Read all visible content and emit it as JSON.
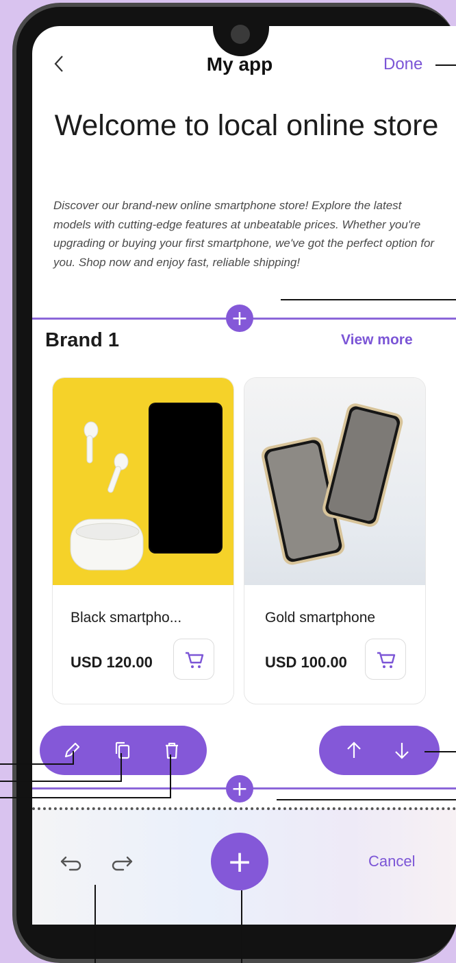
{
  "header": {
    "back_icon": "chevron-left-icon",
    "title": "My app",
    "done_label": "Done"
  },
  "welcome": {
    "title": "Welcome to local online store",
    "description": "Discover our brand-new online smartphone store! Explore the latest models with cutting-edge features at unbeatable prices. Whether you're upgrading or buying your first smartphone, we've got the perfect option for you. Shop now and enjoy fast, reliable shipping!"
  },
  "section": {
    "title": "Brand 1",
    "view_more_label": "View more"
  },
  "products": [
    {
      "name": "Black smartpho...",
      "price": "USD 120.00",
      "image": "black-phone-with-earbuds"
    },
    {
      "name": "Gold smartphone",
      "price": "USD 100.00",
      "image": "gold-phones-pair"
    }
  ],
  "edit_toolbar": {
    "icons": [
      "pencil-icon",
      "copy-icon",
      "trash-icon"
    ]
  },
  "reorder_toolbar": {
    "icons": [
      "arrow-up-icon",
      "arrow-down-icon"
    ]
  },
  "add_block_label": "+",
  "bottom_bar": {
    "undo_icon": "undo-icon",
    "redo_icon": "redo-icon",
    "add_label": "+",
    "cancel_label": "Cancel"
  },
  "colors": {
    "accent": "#8458d8",
    "accent_text": "#7b55d6",
    "background": "#d9c3ef",
    "product_bg_yellow": "#f5d229"
  }
}
